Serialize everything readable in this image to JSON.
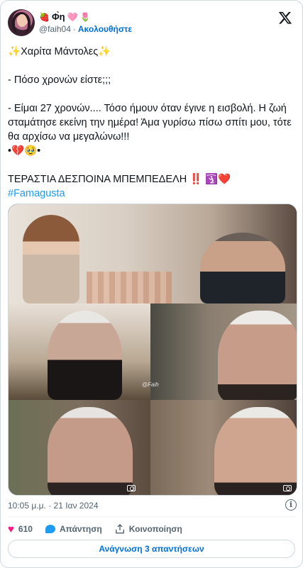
{
  "author": {
    "display_name": "Φ̀η",
    "name_prefix_emoji": "🍓",
    "name_suffix_emojis": [
      "🩷",
      "🌷"
    ],
    "handle": "@faih04",
    "separator": "·",
    "follow_label": "Ακολουθήστε"
  },
  "tweet": {
    "title_line": "Χαρίτα Μάντολες",
    "question": "- Πόσο χρονών είστε;;;",
    "answer": "- Είμαι 27 χρονών.... Τόσο ήμουν όταν έγινε η εισβολή. Η ζωή σταμάτησε εκείνη την ημέρα! Άμα γυρίσω πίσω σπίτι μου, τότε θα αρχίσω να μεγαλώνω!!!",
    "emoji_line": "•💔🥹•",
    "closing_line": "ΤΕΡΑΣΤΙΑ ΔΕΣΠΟΙΝΑ ΜΠΕΜΠΕΔΕΛΗ",
    "closing_marks": "‼️",
    "closing_emojis": "🛐❤️",
    "hashtag": "#Famagusta",
    "sparkle": "✨"
  },
  "media": {
    "watermark": "@Faih"
  },
  "meta": {
    "timestamp": "10:05 μ.μ. · 21 Ιαν 2024"
  },
  "actions": {
    "likes_count": "610",
    "reply_label": "Απάντηση",
    "share_label": "Κοινοποίηση",
    "read_replies_label": "Ανάγνωση 3 απαντήσεων"
  },
  "colors": {
    "link": "#1d9bf0",
    "follow": "#006fd6",
    "like": "#f91880",
    "muted": "#536471"
  }
}
